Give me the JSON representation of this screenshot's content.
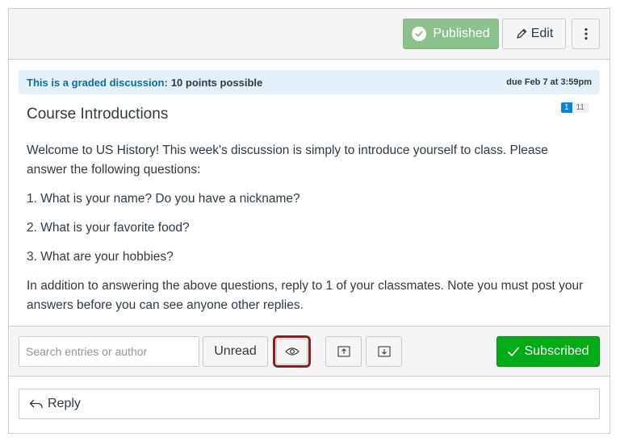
{
  "header": {
    "published_label": "Published",
    "edit_label": "Edit"
  },
  "banner": {
    "lead": "This is a graded discussion:",
    "points": "10 points possible",
    "due": "due Feb 7 at 3:59pm"
  },
  "counts": {
    "unread": "1",
    "total": "11"
  },
  "topic": {
    "title": "Course Introductions",
    "paragraphs": [
      "Welcome to US History! This week's discussion is simply to introduce yourself to class. Please answer the following questions:",
      "1. What is your name? Do you have a nickname?",
      "2. What is your favorite food?",
      "3. What are your hobbies?",
      "In addition to answering the above questions, reply to 1 of your classmates. Note you must post your answers before you can see anyone other replies."
    ]
  },
  "toolbar": {
    "search_placeholder": "Search entries or author",
    "unread_label": "Unread",
    "subscribed_label": "Subscribed"
  },
  "reply": {
    "label": "Reply"
  },
  "colors": {
    "published": "#8cc08c",
    "subscribed": "#00ac18",
    "banner_bg": "#e4f1fb",
    "banner_text": "#0770a3",
    "highlight": "#8f1d22"
  },
  "icons": [
    "check-circle-icon",
    "pencil-icon",
    "kebab-icon",
    "eye-icon",
    "collapse-icon",
    "expand-icon",
    "checkmark-icon",
    "reply-arrow-icon"
  ]
}
